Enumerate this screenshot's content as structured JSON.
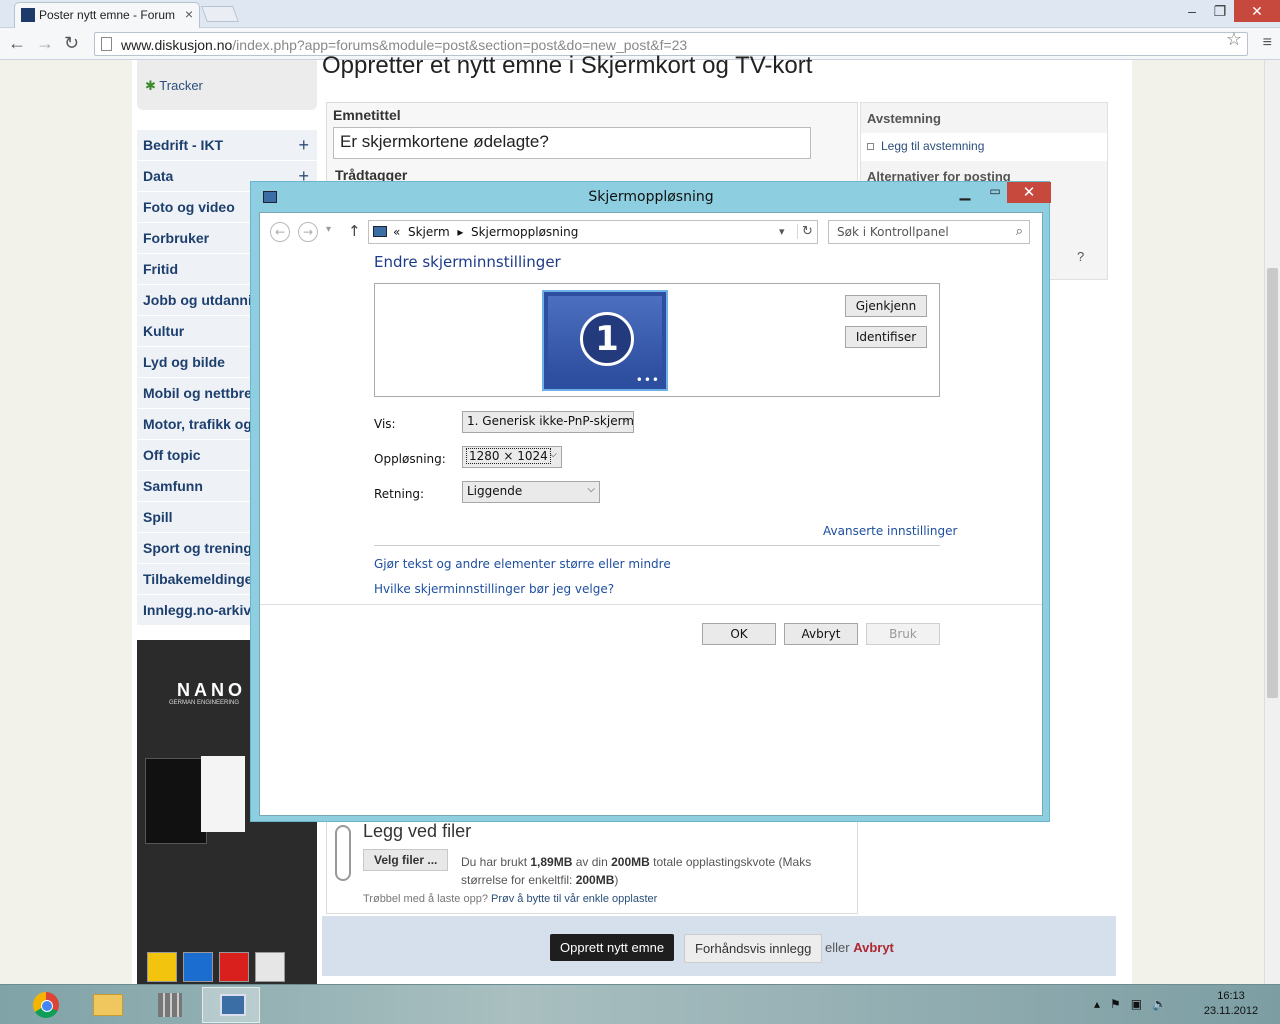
{
  "browser": {
    "tab_title": "Poster nytt emne - Forum",
    "tab_close": "×",
    "url_host": "www.diskusjon.no",
    "url_path": "/index.php?app=forums&module=post&section=post&do=new_post&f=23",
    "window_controls": [
      "–",
      "❐",
      "✕"
    ]
  },
  "sidebar": {
    "tracker_label": "Tracker",
    "categories": [
      {
        "label": "Bedrift - IKT",
        "plus": "+"
      },
      {
        "label": "Data",
        "plus": "+"
      },
      {
        "label": "Foto og video"
      },
      {
        "label": "Forbruker"
      },
      {
        "label": "Fritid"
      },
      {
        "label": "Jobb og utdanning"
      },
      {
        "label": "Kultur"
      },
      {
        "label": "Lyd og bilde"
      },
      {
        "label": "Mobil og nettbrett"
      },
      {
        "label": "Motor, trafikk og"
      },
      {
        "label": "Off topic"
      },
      {
        "label": "Samfunn"
      },
      {
        "label": "Spill"
      },
      {
        "label": "Sport og trening"
      },
      {
        "label": "Tilbakemeldinger"
      },
      {
        "label": "Innlegg.no-arkiv"
      }
    ],
    "ad_logo": "NANO",
    "ad_sub": "GERMAN ENGINEERING"
  },
  "forum": {
    "heading": "Oppretter et nytt emne i Skjermkort og TV-kort",
    "subject_label": "Emnetittel",
    "subject_value": "Er skjermkortene ødelagte?",
    "tags_label": "Trådtagger",
    "right_panel": {
      "poll_header": "Avstemning",
      "poll_link": "Legg til avstemning",
      "options_header": "Alternativer for posting",
      "question_mark": "?"
    },
    "attach": {
      "title": "Legg ved filer",
      "choose_button": "Velg filer ...",
      "info_prefix": "Du har brukt ",
      "used": "1,89MB",
      "info_mid": " av din ",
      "quota": "200MB",
      "info_suffix": " totale opplastingskvote (Maks størrelse for enkeltfil: ",
      "max_file": "200MB",
      "info_end": ")",
      "help_text": "Trøbbel med å laste opp? ",
      "help_link": "Prøv å bytte til vår enkle opplaster"
    },
    "buttons": {
      "create": "Opprett nytt emne",
      "preview": "Forhåndsvis innlegg",
      "or_text": "eller ",
      "cancel_link": "Avbryt"
    }
  },
  "dialog": {
    "title": "Skjermoppløsning",
    "breadcrumb_prefix": "«",
    "breadcrumb": [
      "Skjerm",
      "Skjermoppløsning"
    ],
    "search_placeholder": "Søk i Kontrollpanel",
    "heading": "Endre skjerminnstillinger",
    "monitor_number": "1",
    "detect_button": "Gjenkjenn",
    "identify_button": "Identifiser",
    "display_label": "Vis:",
    "display_value": "1. Generisk ikke-PnP-skjerm",
    "resolution_label": "Oppløsning:",
    "resolution_value": "1280 × 1024",
    "orientation_label": "Retning:",
    "orientation_value": "Liggende",
    "advanced_link": "Avanserte innstillinger",
    "text_size_link": "Gjør tekst og andre elementer større eller mindre",
    "which_settings_link": "Hvilke skjerminnstillinger bør jeg velge?",
    "ok_button": "OK",
    "cancel_button": "Avbryt",
    "apply_button": "Bruk"
  },
  "taskbar": {
    "time": "16:13",
    "date": "23.11.2012"
  },
  "colors": {
    "dialog_frame": "#8dcfe0",
    "close_red": "#c7493e",
    "link_blue": "#1e4fa0",
    "forum_cancel": "#b0282f"
  }
}
